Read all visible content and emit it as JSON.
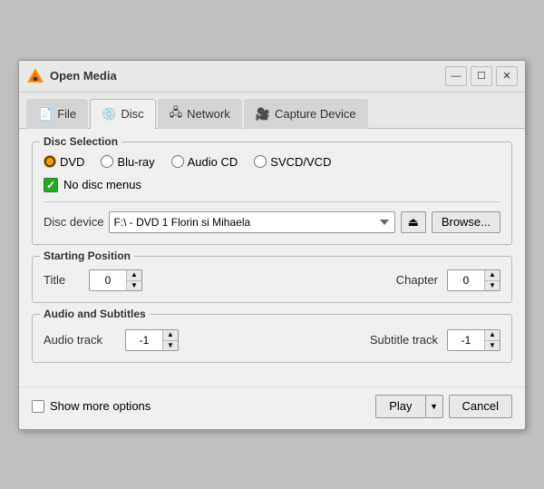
{
  "window": {
    "title": "Open Media",
    "minimize_label": "—",
    "maximize_label": "☐",
    "close_label": "✕"
  },
  "tabs": [
    {
      "id": "file",
      "label": "File",
      "icon": "📄",
      "active": false
    },
    {
      "id": "disc",
      "label": "Disc",
      "icon": "💿",
      "active": true
    },
    {
      "id": "network",
      "label": "Network",
      "icon": "🖧",
      "active": false
    },
    {
      "id": "capture",
      "label": "Capture Device",
      "icon": "🎥",
      "active": false
    }
  ],
  "disc_selection": {
    "group_label": "Disc Selection",
    "radios": [
      "DVD",
      "Blu-ray",
      "Audio CD",
      "SVCD/VCD"
    ],
    "selected": "DVD",
    "no_disc_menus_label": "No disc menus",
    "no_disc_menus_checked": true,
    "device_label": "Disc device",
    "device_value": "F:\\ - DVD 1 Florin si Mihaela",
    "eject_icon": "⏏",
    "browse_label": "Browse..."
  },
  "starting_position": {
    "group_label": "Starting Position",
    "title_label": "Title",
    "title_value": "0",
    "chapter_label": "Chapter",
    "chapter_value": "0"
  },
  "audio_subtitles": {
    "group_label": "Audio and Subtitles",
    "audio_label": "Audio track",
    "audio_value": "-1",
    "subtitle_label": "Subtitle track",
    "subtitle_value": "-1"
  },
  "bottom": {
    "show_more_label": "Show more options",
    "play_label": "Play",
    "cancel_label": "Cancel"
  }
}
